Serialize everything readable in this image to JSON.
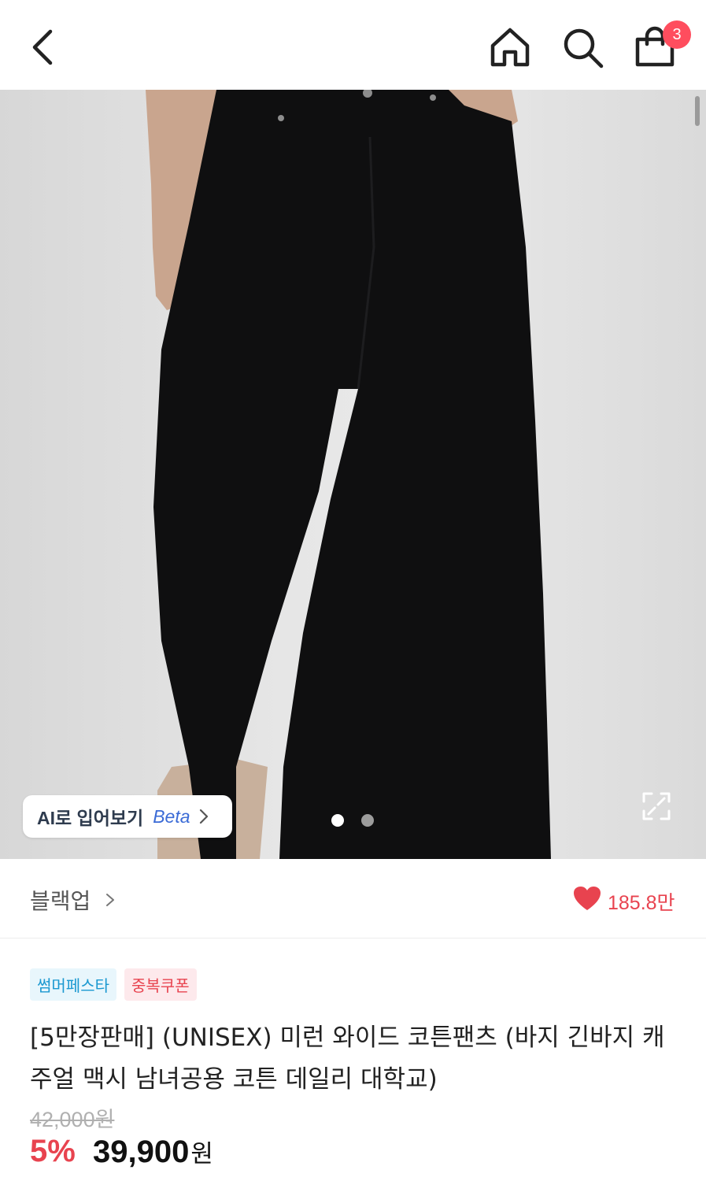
{
  "header": {
    "cart_count": "3"
  },
  "gallery": {
    "ai_tryon_label": "AI로 입어보기",
    "ai_tryon_badge": "Beta",
    "current_slide": 1,
    "slide_count": 2
  },
  "brand": {
    "name": "블랙업",
    "likes": "185.8만"
  },
  "product": {
    "tags": [
      "썸머페스타",
      "중복쿠폰"
    ],
    "title": "[5만장판매] (UNISEX) 미런 와이드 코튼팬츠 (바지 긴바지 캐주얼 맥시 남녀공용 코튼 데일리 대학교)",
    "original_price": "42,000원",
    "discount": "5%",
    "price": "39,900",
    "price_unit": "원"
  },
  "colors": {
    "accent": "#e8434f",
    "festa_tag": "#1a98d0",
    "beta_blue": "#3b6bd6"
  }
}
